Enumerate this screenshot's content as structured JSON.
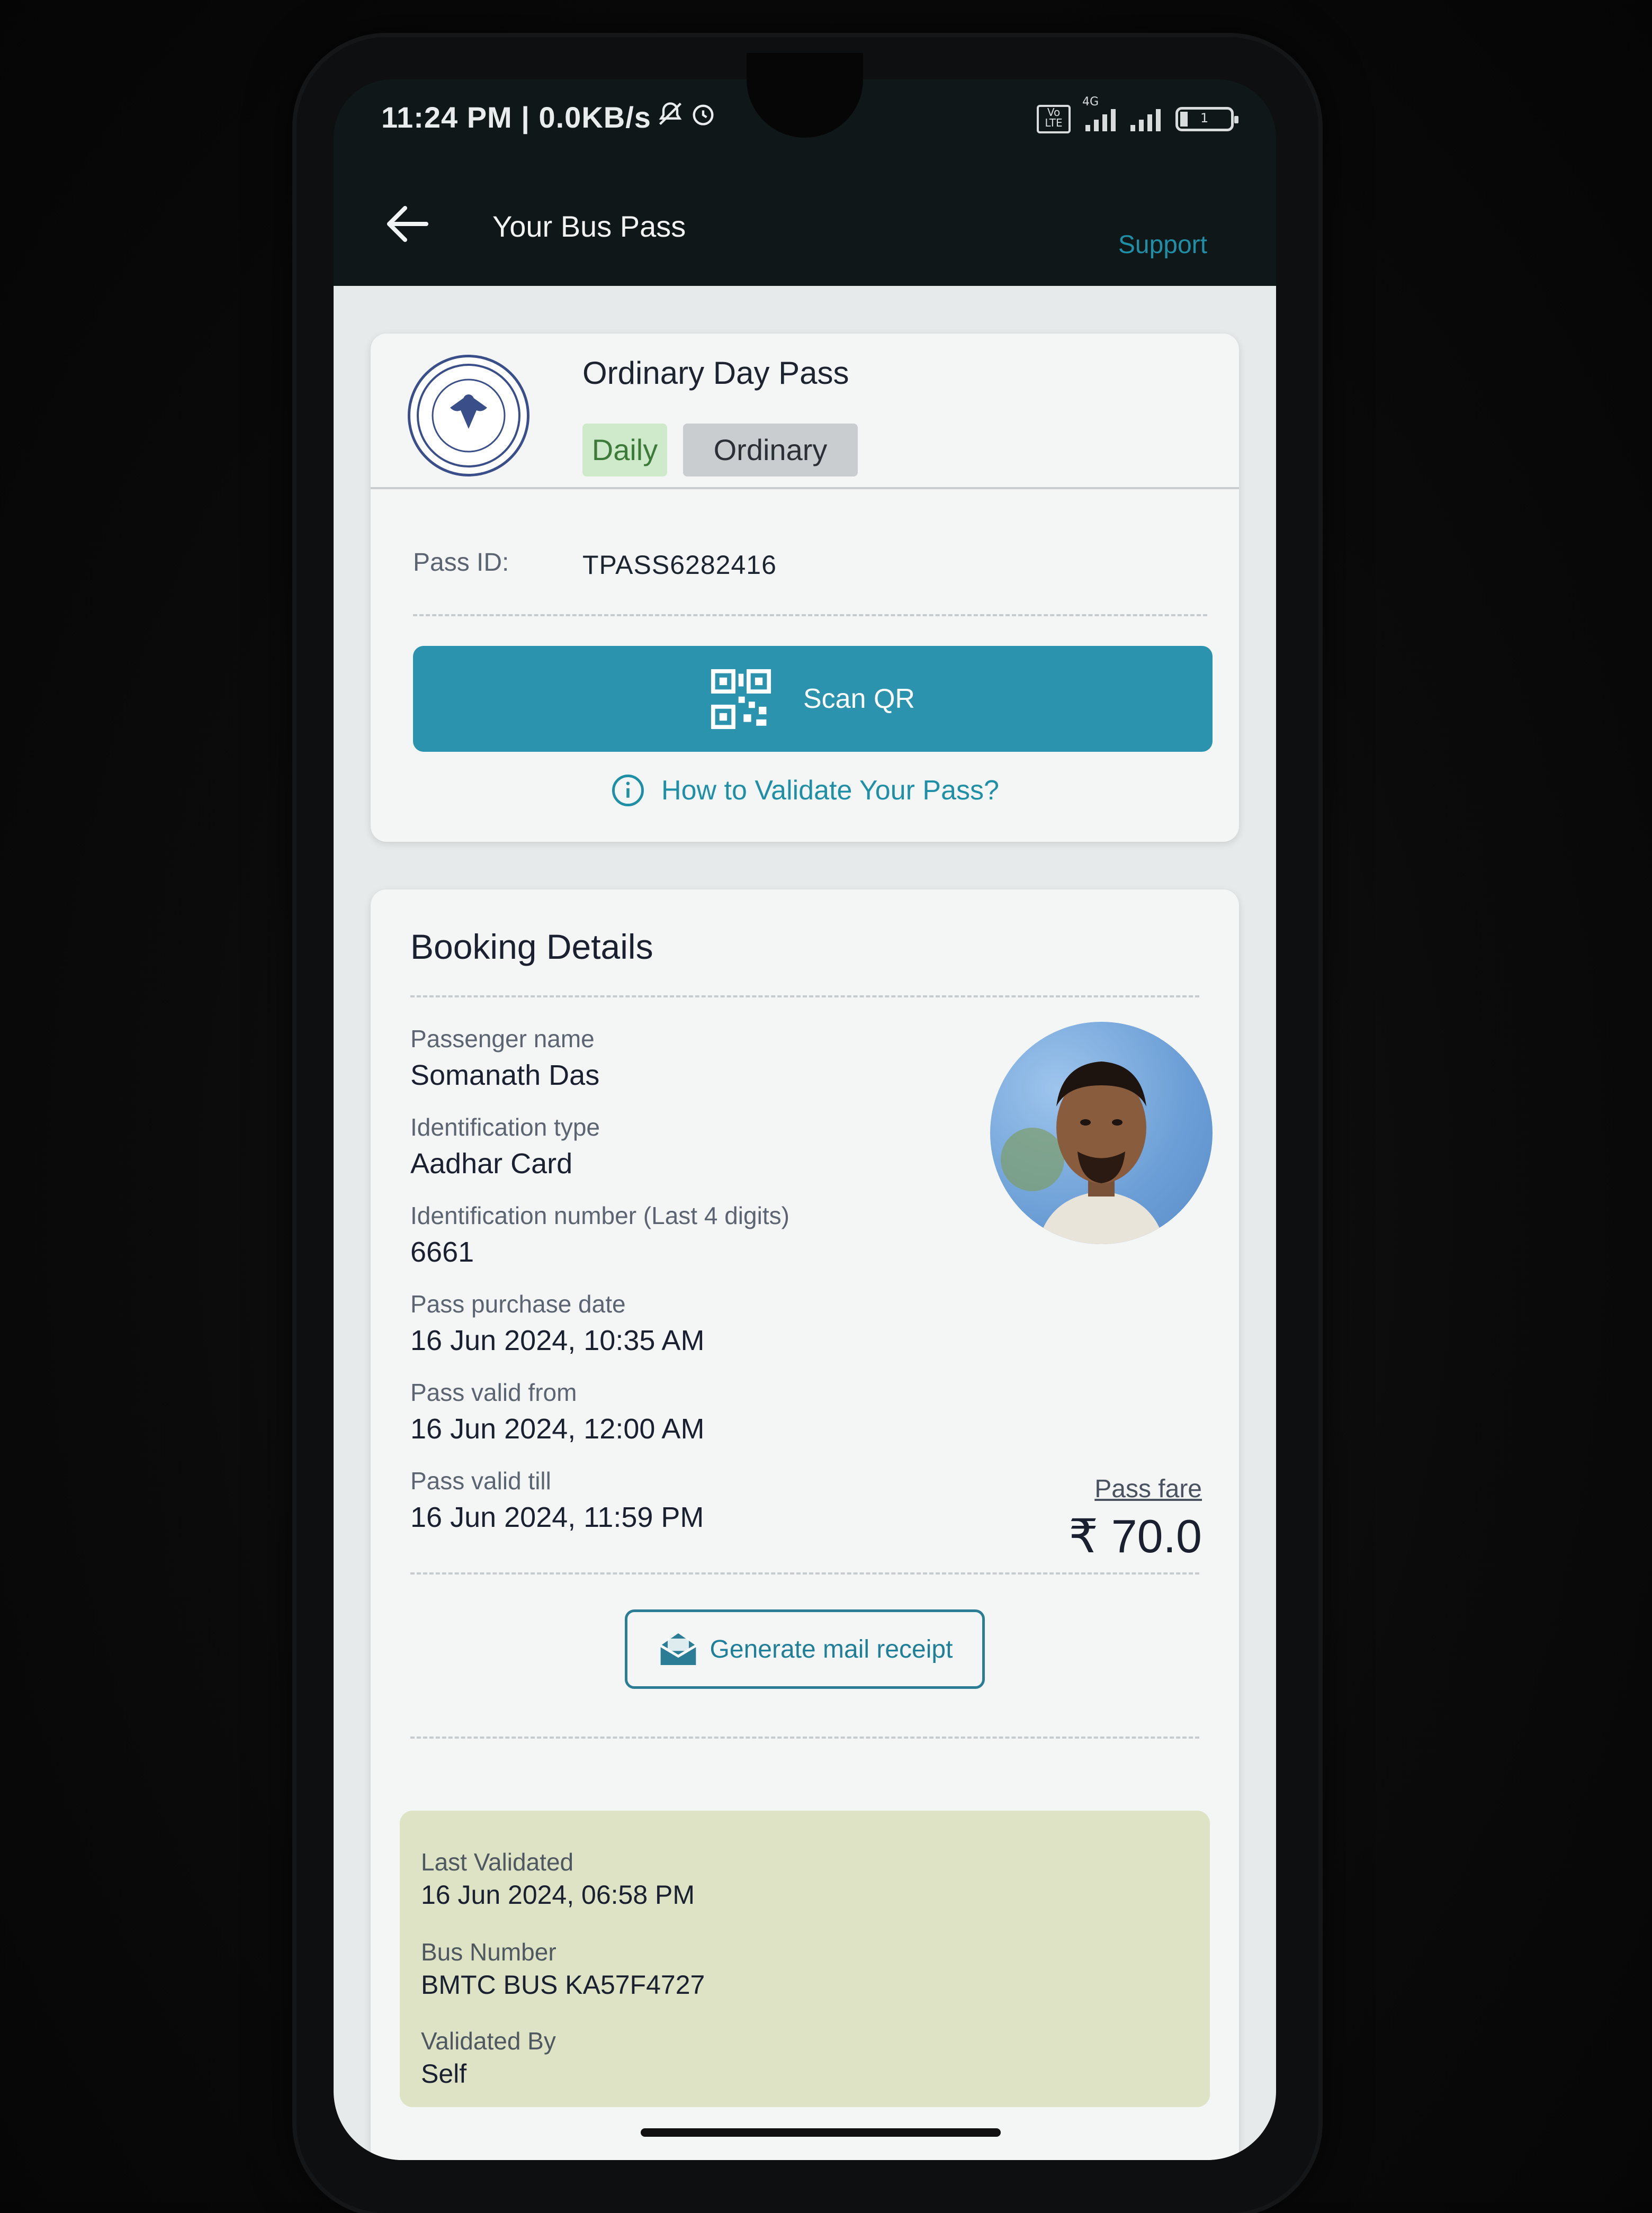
{
  "status_bar": {
    "time_speed": "11:24 PM | 0.0KB/s",
    "icons": [
      "mute-icon",
      "alarm-icon",
      "volte-icon",
      "signal-icon",
      "battery-icon"
    ],
    "volte_label": "Vo LTE",
    "network_label": "4G",
    "battery_level": "1"
  },
  "app_bar": {
    "title": "Your Bus Pass",
    "support_label": "Support"
  },
  "pass_card": {
    "title": "Ordinary Day Pass",
    "tags": [
      "Daily",
      "Ordinary"
    ],
    "pass_id_label": "Pass ID:",
    "pass_id_value": "TPASS6282416",
    "scan_button_label": "Scan QR",
    "validate_help_link": "How to Validate Your Pass?"
  },
  "booking": {
    "title": "Booking Details",
    "passenger_name_label": "Passenger name",
    "passenger_name": "Somanath Das",
    "id_type_label": "Identification type",
    "id_type": "Aadhar Card",
    "id_number_label": "Identification number (Last 4 digits)",
    "id_number": "6661",
    "purchase_date_label": "Pass purchase date",
    "purchase_date": "16 Jun 2024, 10:35 AM",
    "valid_from_label": "Pass valid from",
    "valid_from": "16 Jun 2024, 12:00 AM",
    "valid_till_label": "Pass valid till",
    "valid_till": "16 Jun 2024, 11:59 PM",
    "fare_label": "Pass fare",
    "fare_value": "₹ 70.0",
    "mail_button_label": "Generate mail receipt"
  },
  "validation": {
    "last_validated_label": "Last Validated",
    "last_validated": "16 Jun 2024, 06:58 PM",
    "bus_number_label": "Bus Number",
    "bus_number": "BMTC BUS KA57F4727",
    "validated_by_label": "Validated By",
    "validated_by": "Self"
  },
  "colors": {
    "accent": "#2b93ae",
    "link": "#1f8fa6",
    "appbar": "#0f1719",
    "daily_chip": "#cfeacb",
    "ordinary_chip": "#c9cdcf",
    "validated_box": "#dde3c4"
  }
}
